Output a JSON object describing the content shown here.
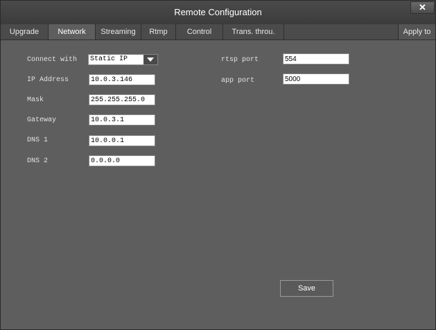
{
  "window": {
    "title": "Remote Configuration",
    "close_glyph": "✕"
  },
  "tabs": [
    {
      "label": "Upgrade"
    },
    {
      "label": "Network",
      "active": true
    },
    {
      "label": "Streaming"
    },
    {
      "label": "Rtmp"
    },
    {
      "label": "Control"
    },
    {
      "label": "Trans. throu."
    }
  ],
  "apply_tab": {
    "label": "Apply to"
  },
  "form": {
    "connect_with": {
      "label": "Connect with",
      "value": "Static IP"
    },
    "ip_address": {
      "label": "IP Address",
      "value": "10.0.3.146"
    },
    "mask": {
      "label": "Mask",
      "value": "255.255.255.0"
    },
    "gateway": {
      "label": "Gateway",
      "value": "10.0.3.1"
    },
    "dns1": {
      "label": "DNS 1",
      "value": "10.0.0.1"
    },
    "dns2": {
      "label": "DNS 2",
      "value": "0.0.0.0"
    },
    "rtsp_port": {
      "label": "rtsp port",
      "value": "554"
    },
    "app_port": {
      "label": "app port",
      "value": "5000"
    }
  },
  "save_button": {
    "label": "Save"
  },
  "colors": {
    "panel": "#5e5e5e",
    "titlebar": "#3c3c3c",
    "tabbar": "#4b4b4b",
    "text": "#e2e2e2"
  },
  "icons": {
    "dropdown": "chevron-down-icon",
    "close": "close-icon"
  }
}
